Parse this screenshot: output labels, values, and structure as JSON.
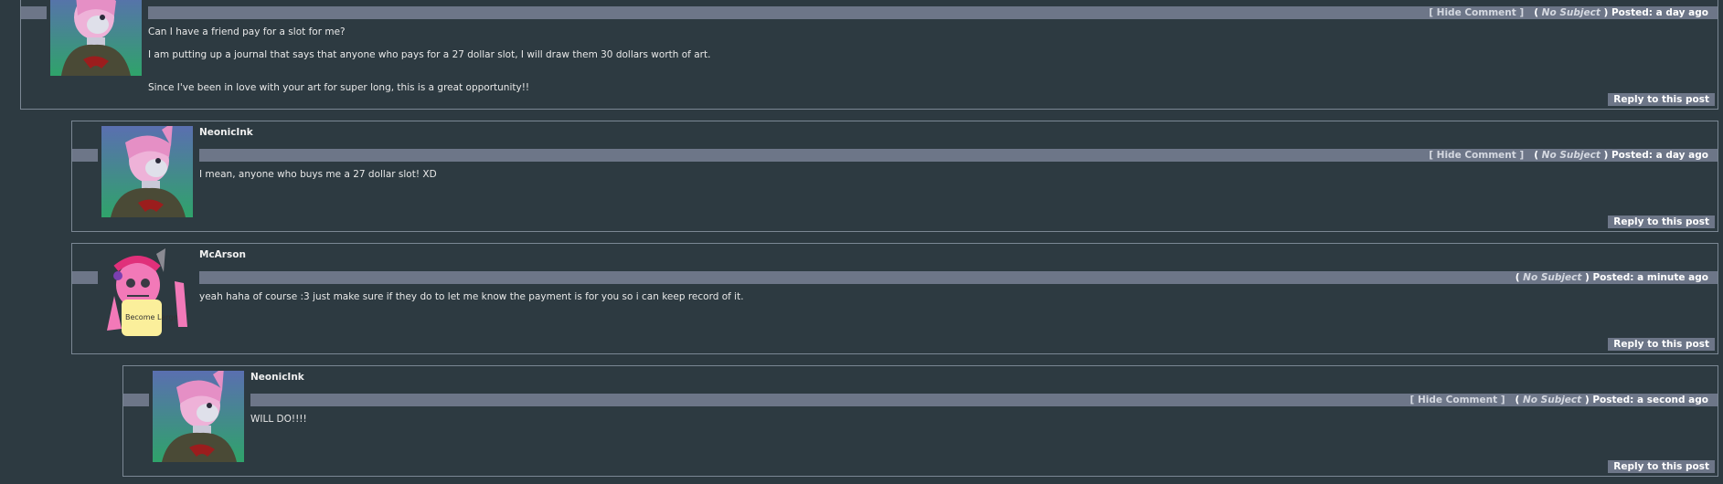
{
  "comments": [
    {
      "username": "",
      "hide_label": "[ Hide Comment ]",
      "subject_open": "(",
      "subject": "No Subject",
      "subject_close": ")",
      "posted": "Posted: a day ago",
      "paragraphs": [
        "Can I have a friend pay for a slot for me?",
        "I am putting up a journal that says that anyone who pays for a 27 dollar slot, I will draw them 30 dollars worth of art.",
        "Since I've been in love with your art for super long, this is a great opportunity!!"
      ],
      "reply_label": "Reply to this post"
    },
    {
      "username": "NeonicInk",
      "hide_label": "[ Hide Comment ]",
      "subject_open": "(",
      "subject": "No Subject",
      "subject_close": ")",
      "posted": "Posted: a day ago",
      "paragraphs": [
        "I mean, anyone who buys me a 27 dollar slot! XD"
      ],
      "reply_label": "Reply to this post"
    },
    {
      "username": "McArson",
      "subject_open": "(",
      "subject": "No Subject",
      "subject_close": ")",
      "posted": "Posted: a minute ago",
      "paragraphs": [
        "yeah haha of course :3 just make sure if they do to let me know the payment is for you so i can keep record of it."
      ],
      "avatar_text": "Become Large",
      "reply_label": "Reply to this post"
    },
    {
      "username": "NeonicInk",
      "hide_label": "[ Hide Comment ]",
      "subject_open": "(",
      "subject": "No Subject",
      "subject_close": ")",
      "posted": "Posted: a second ago",
      "paragraphs": [
        "WILL DO!!!!"
      ],
      "reply_label": "Reply to this post"
    }
  ]
}
